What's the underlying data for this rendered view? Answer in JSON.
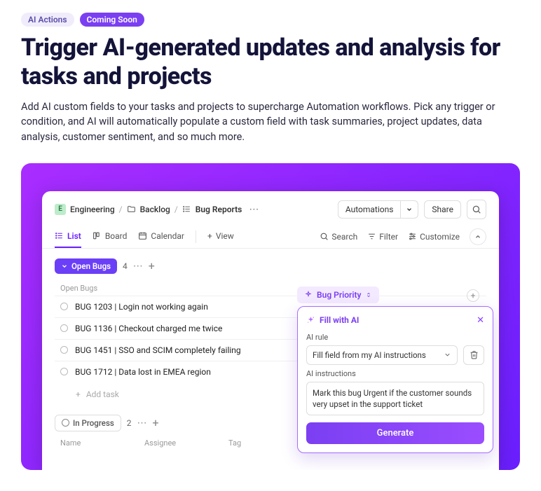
{
  "hero": {
    "badge1": "AI Actions",
    "badge2": "Coming Soon",
    "title": "Trigger AI-generated updates and analysis for tasks and projects",
    "desc": "Add AI custom fields to your tasks and projects to supercharge Automation workflows. Pick any trigger or condition, and AI will automatically populate a custom field with task summaries, project updates, data analysis, customer sentiment, and so much more."
  },
  "breadcrumbs": {
    "space_letter": "E",
    "space": "Engineering",
    "folder": "Backlog",
    "list": "Bug Reports"
  },
  "header": {
    "automations": "Automations",
    "share": "Share"
  },
  "tabs": {
    "list": "List",
    "board": "Board",
    "calendar": "Calendar",
    "addview": "View"
  },
  "toolbar": {
    "search": "Search",
    "filter": "Filter",
    "customize": "Customize"
  },
  "group1": {
    "name": "Open Bugs",
    "count": "4",
    "col_name": "Open Bugs",
    "priority_col": "Bug Priority",
    "rows": [
      "BUG 1203 | Login not working again",
      "BUG 1136 | Checkout charged me twice",
      "BUG 1451 | SSO and SCIM completely failing",
      "BUG 1712 | Data lost in EMEA region"
    ],
    "addtask": "Add task"
  },
  "group2": {
    "name": "In Progress",
    "count": "2",
    "col_name": "Name",
    "col_assignee": "Assignee",
    "col_tag": "Tag"
  },
  "popover": {
    "title": "Fill with AI",
    "rule_label": "AI rule",
    "rule_value": "Fill field from my AI instructions",
    "instr_label": "AI instructions",
    "instr_value": "Mark this bug Urgent if the customer sounds very upset in the support ticket",
    "generate": "Generate"
  }
}
